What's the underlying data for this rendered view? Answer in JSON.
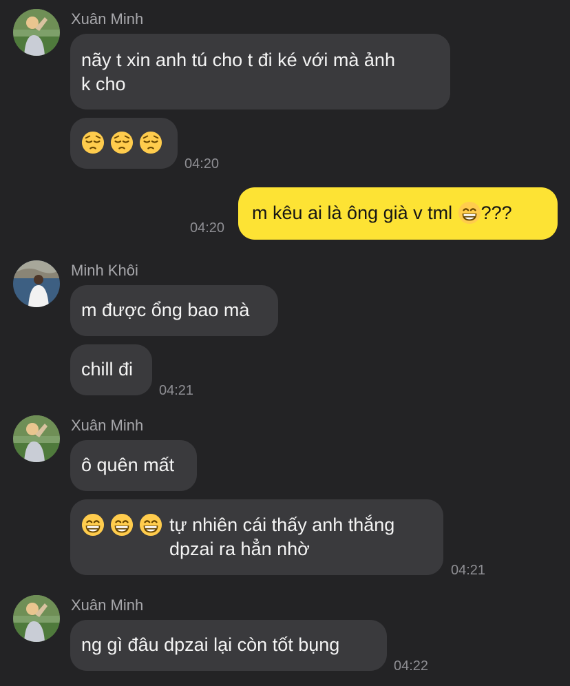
{
  "colors": {
    "background": "#232325",
    "incoming_bubble": "#3a3a3d",
    "outgoing_bubble": "#fde334",
    "meta_text": "#8e8e93"
  },
  "messages": [
    {
      "sender": "Xuân Minh",
      "bubbles": [
        {
          "text": "nãy t xin anh tú cho t đi ké với mà ảnh\nk cho"
        },
        {
          "emoji": [
            "pensive-face",
            "pensive-face",
            "pensive-face"
          ],
          "time": "04:20"
        }
      ]
    },
    {
      "sender": "me",
      "bubbles": [
        {
          "text_before": "m kêu ai là ông già v tml ",
          "emoji": [
            "grinning-face"
          ],
          "text_after": "???",
          "time": "04:20"
        }
      ]
    },
    {
      "sender": "Minh Khôi",
      "bubbles": [
        {
          "text": "m được ổng bao mà"
        },
        {
          "text": "chill đi",
          "time": "04:21"
        }
      ]
    },
    {
      "sender": "Xuân Minh",
      "bubbles": [
        {
          "text": "ô quên mất"
        },
        {
          "emoji": [
            "grinning-face",
            "grinning-face",
            "grinning-face"
          ],
          "text": "tự nhiên cái thấy anh thắng\ndpzai ra hẳn nhờ",
          "time": "04:21"
        }
      ]
    },
    {
      "sender": "Xuân Minh",
      "bubbles": [
        {
          "text": "ng gì đâu dpzai lại còn tốt bụng",
          "time": "04:22"
        }
      ]
    }
  ]
}
